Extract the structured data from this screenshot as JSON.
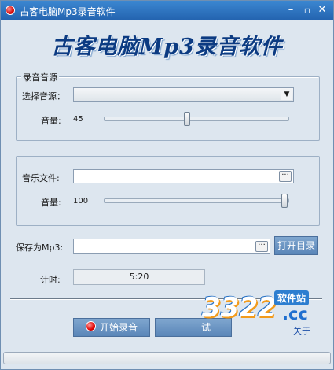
{
  "window": {
    "title": "古客电脑Mp3录音软件"
  },
  "heading": "古客电脑Mp3录音软件",
  "source_group": {
    "title": "录音音源",
    "source_label": "选择音源：",
    "source_value": "",
    "volume_label": "音量:",
    "volume_value": "45",
    "volume_level": 0.45
  },
  "music_group": {
    "file_label": "音乐文件:",
    "file_value": "",
    "browse_label": "···",
    "volume_label": "音量:",
    "volume_value": "100",
    "volume_level": 1.0
  },
  "save": {
    "label": "保存为Mp3:",
    "value": "",
    "browse_label": "···",
    "open_dir_label": "打开目录"
  },
  "timer": {
    "label": "计时:",
    "value": "5:20"
  },
  "actions": {
    "record_label": "开始录音",
    "trial_label": "试",
    "about_label": "关于"
  },
  "watermark": {
    "digits": "3322",
    "site_text": "软件站",
    "domain_text": ".cc"
  },
  "colors": {
    "accent": "#2f74c0",
    "heading": "#0c3b82",
    "button": "#5f8bbd",
    "record": "#e00000"
  },
  "icons": {
    "app": "record-icon",
    "dropdown": "chevron-down-icon",
    "minimize": "minimize-icon",
    "close": "close-icon"
  }
}
